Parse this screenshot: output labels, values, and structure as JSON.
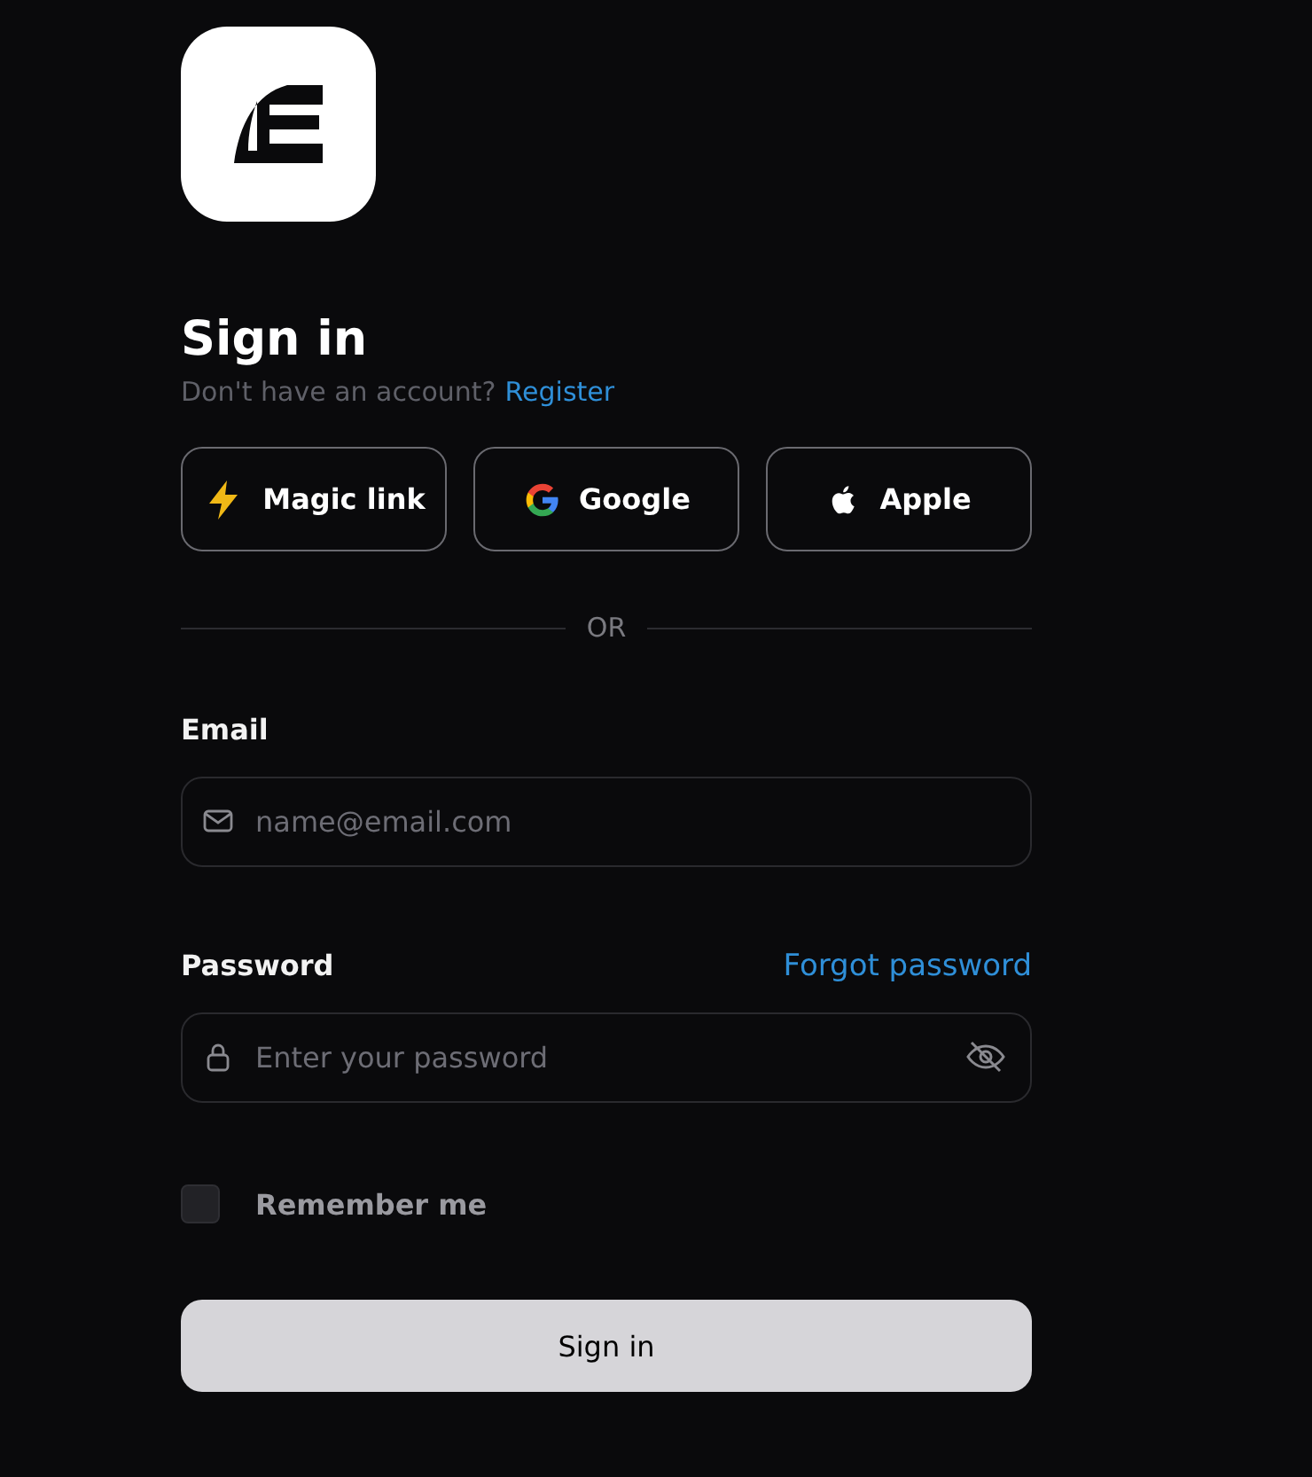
{
  "title": "Sign in",
  "subtitle": {
    "text": "Don't have an account?",
    "link": "Register"
  },
  "providers": [
    {
      "kind": "magic",
      "label": "Magic link"
    },
    {
      "kind": "google",
      "label": "Google"
    },
    {
      "kind": "apple",
      "label": "Apple"
    }
  ],
  "divider": "OR",
  "email": {
    "label": "Email",
    "placeholder": "name@email.com"
  },
  "password": {
    "label": "Password",
    "link": "Forgot password",
    "placeholder": "Enter your password"
  },
  "remember": {
    "label": "Remember me",
    "checked": false
  },
  "submit": "Sign in"
}
